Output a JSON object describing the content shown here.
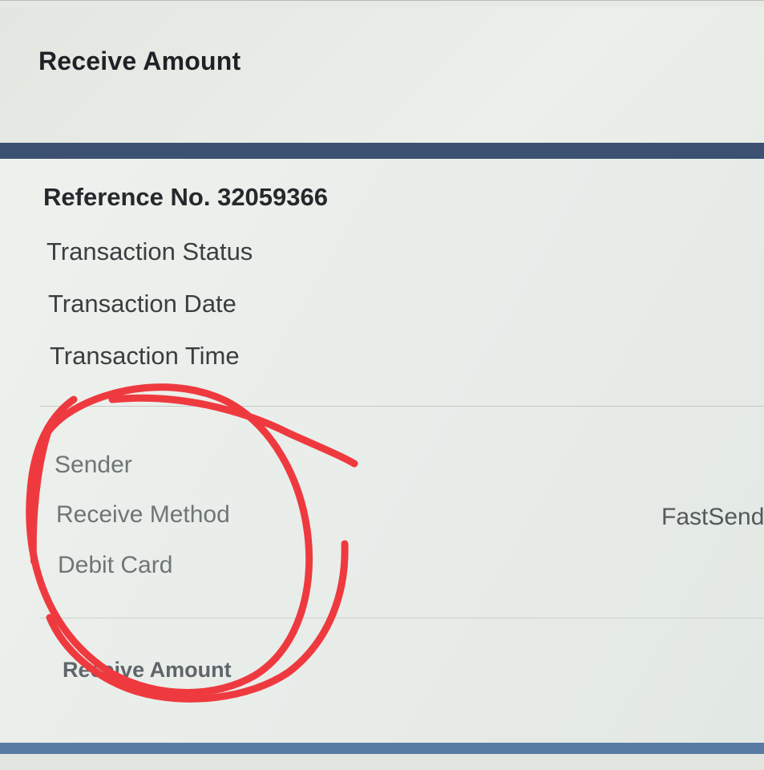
{
  "header": {
    "title": "Receive Amount"
  },
  "transaction": {
    "reference_line": "Reference No. 32059366",
    "status_label": "Transaction Status",
    "date_label": "Transaction Date",
    "time_label": "Transaction Time"
  },
  "details": {
    "sender_label": "Sender",
    "receive_method_label": "Receive Method",
    "receive_method_value": "FastSend",
    "debit_card_label": "Debit Card",
    "receive_amount_label": "Receive Amount"
  },
  "colors": {
    "header_bar": "#3c5172",
    "footer_bar": "#587ba3",
    "annotation_circle": "#ee3a3f"
  }
}
